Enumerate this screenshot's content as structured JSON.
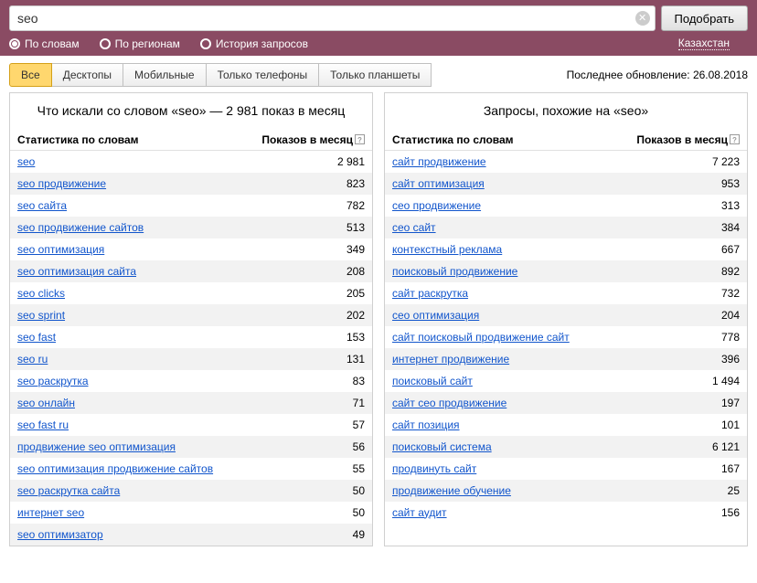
{
  "search": {
    "value": "seo",
    "submit_label": "Подобрать"
  },
  "radios": {
    "by_words": "По словам",
    "by_regions": "По регионам",
    "history": "История запросов"
  },
  "region": "Казахстан",
  "tabs": {
    "all": "Все",
    "desktops": "Десктопы",
    "mobile": "Мобильные",
    "phones": "Только телефоны",
    "tablets": "Только планшеты"
  },
  "updated_label": "Последнее обновление: 26.08.2018",
  "left": {
    "title": "Что искали со словом «seo» — 2 981 показ в месяц",
    "header_stat": "Статистика по словам",
    "header_views": "Показов в месяц",
    "rows": [
      {
        "q": "seo",
        "v": "2 981"
      },
      {
        "q": "seo продвижение",
        "v": "823"
      },
      {
        "q": "seo сайта",
        "v": "782"
      },
      {
        "q": "seo продвижение сайтов",
        "v": "513"
      },
      {
        "q": "seo оптимизация",
        "v": "349"
      },
      {
        "q": "seo оптимизация сайта",
        "v": "208"
      },
      {
        "q": "seo clicks",
        "v": "205"
      },
      {
        "q": "seo sprint",
        "v": "202"
      },
      {
        "q": "seo fast",
        "v": "153"
      },
      {
        "q": "seo ru",
        "v": "131"
      },
      {
        "q": "seo раскрутка",
        "v": "83"
      },
      {
        "q": "seo онлайн",
        "v": "71"
      },
      {
        "q": "seo fast ru",
        "v": "57"
      },
      {
        "q": "продвижение seo оптимизация",
        "v": "56"
      },
      {
        "q": "seo оптимизация продвижение сайтов",
        "v": "55"
      },
      {
        "q": "seo раскрутка сайта",
        "v": "50"
      },
      {
        "q": "интернет seo",
        "v": "50"
      },
      {
        "q": "seo оптимизатор",
        "v": "49"
      }
    ]
  },
  "right": {
    "title": "Запросы, похожие на «seo»",
    "header_stat": "Статистика по словам",
    "header_views": "Показов в месяц",
    "rows": [
      {
        "q": "сайт продвижение",
        "v": "7 223"
      },
      {
        "q": "сайт оптимизация",
        "v": "953"
      },
      {
        "q": "сео продвижение",
        "v": "313"
      },
      {
        "q": "сео сайт",
        "v": "384"
      },
      {
        "q": "контекстный реклама",
        "v": "667"
      },
      {
        "q": "поисковый продвижение",
        "v": "892"
      },
      {
        "q": "сайт раскрутка",
        "v": "732"
      },
      {
        "q": "сео оптимизация",
        "v": "204"
      },
      {
        "q": "сайт поисковый продвижение сайт",
        "v": "778"
      },
      {
        "q": "интернет продвижение",
        "v": "396"
      },
      {
        "q": "поисковый сайт",
        "v": "1 494"
      },
      {
        "q": "сайт сео продвижение",
        "v": "197"
      },
      {
        "q": "сайт позиция",
        "v": "101"
      },
      {
        "q": "поисковый система",
        "v": "6 121"
      },
      {
        "q": "продвинуть сайт",
        "v": "167"
      },
      {
        "q": "продвижение обучение",
        "v": "25"
      },
      {
        "q": "сайт аудит",
        "v": "156"
      }
    ]
  }
}
